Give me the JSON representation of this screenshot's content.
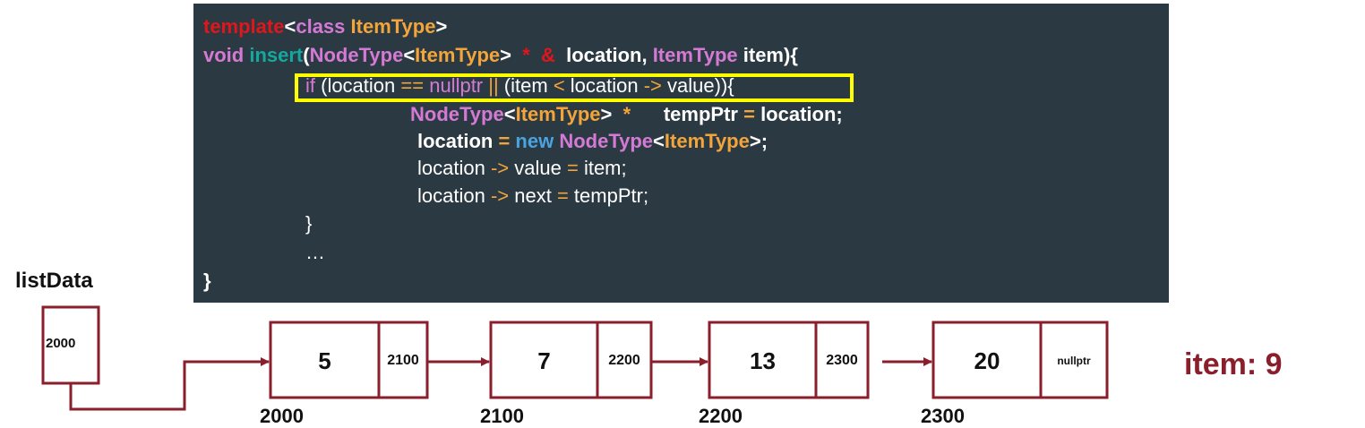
{
  "code": {
    "line1": {
      "t1": "template",
      "t2": "<",
      "t3": "class",
      "t4": " ItemType",
      "t5": ">"
    },
    "line2": {
      "t1": "void ",
      "t2": "insert",
      "t3": "(",
      "t4": "NodeType",
      "t5": "<",
      "t6": "ItemType",
      "t7": ">",
      "t8": "  *  &",
      "t9": "  location, ",
      "t10": "ItemType",
      "t11": " item){"
    },
    "line3": {
      "t1": "if",
      "t2": " (location ",
      "t3": "==",
      "t4": " nullptr",
      "t5": " ||",
      "t6": " (item ",
      "t7": "<",
      "t8": " location ",
      "t9": "->",
      "t10": " value)){"
    },
    "line4": {
      "t1": "NodeType",
      "t2": "<",
      "t3": "ItemType",
      "t4": ">  ",
      "t5": "*",
      "t6": "      tempPtr ",
      "t7": "=",
      "t8": " location;"
    },
    "line5": {
      "t1": "location ",
      "t2": "=",
      "t3": " new",
      "t4": " NodeType",
      "t5": "<",
      "t6": "ItemType",
      "t7": ">;"
    },
    "line6": {
      "t1": "location ",
      "t2": "->",
      "t3": " value ",
      "t4": "=",
      "t5": " item;"
    },
    "line7": {
      "t1": "location ",
      "t2": "->",
      "t3": " next ",
      "t4": "=",
      "t5": " tempPtr;"
    },
    "line8": "}",
    "line9": "…",
    "line10": "}"
  },
  "diagram": {
    "list_label": "listData",
    "head_value": "2000",
    "nodes": [
      {
        "value": "5",
        "next": "2100",
        "address": "2000"
      },
      {
        "value": "7",
        "next": "2200",
        "address": "2100"
      },
      {
        "value": "13",
        "next": "2300",
        "address": "2200"
      },
      {
        "value": "20",
        "next": "nullptr",
        "address": "2300"
      }
    ],
    "item_label": "item: 9"
  },
  "colors": {
    "panel_bg": "#2b3a42",
    "highlight": "#ffff00",
    "node_border": "#8b1e2b",
    "keyword_red": "#e0161b",
    "type_orange": "#f3a43a",
    "fn_teal": "#14a89e",
    "type_pink": "#d57ad4",
    "kw_blue": "#4aa3e0"
  }
}
